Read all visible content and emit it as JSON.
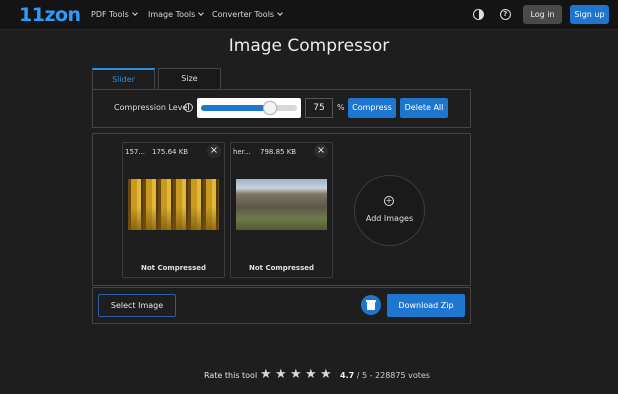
{
  "header": {
    "logo": "11zon",
    "nav": [
      {
        "label": "PDF Tools"
      },
      {
        "label": "Image Tools"
      },
      {
        "label": "Converter Tools"
      }
    ],
    "login_label": "Log in",
    "signup_label": "Sign up",
    "icons": [
      "contrast-icon",
      "help-icon"
    ]
  },
  "page": {
    "title": "Image Compressor",
    "tabs": [
      {
        "label": "Slider",
        "active": true
      },
      {
        "label": "Size",
        "active": false
      }
    ]
  },
  "controls": {
    "compression_label": "Compression Level",
    "compression_value": "75",
    "compression_fraction": 0.75,
    "unit": "%",
    "compress_label": "Compress",
    "delete_all_label": "Delete All"
  },
  "files": [
    {
      "name": "157...",
      "size": "175.64 KB",
      "status": "Not Compressed"
    },
    {
      "name": "her...",
      "size": "798.85 KB",
      "status": "Not Compressed"
    }
  ],
  "add_images_label": "Add Images",
  "actions": {
    "select_label": "Select Image",
    "download_label": "Download Zip"
  },
  "rating": {
    "label": "Rate this tool",
    "stars": 5,
    "score": "4.7",
    "detail": " / 5 - 228875 votes"
  },
  "colors": {
    "accent": "#1f76cf",
    "logo": "#2d9cff",
    "background": "#1e1e1e"
  }
}
